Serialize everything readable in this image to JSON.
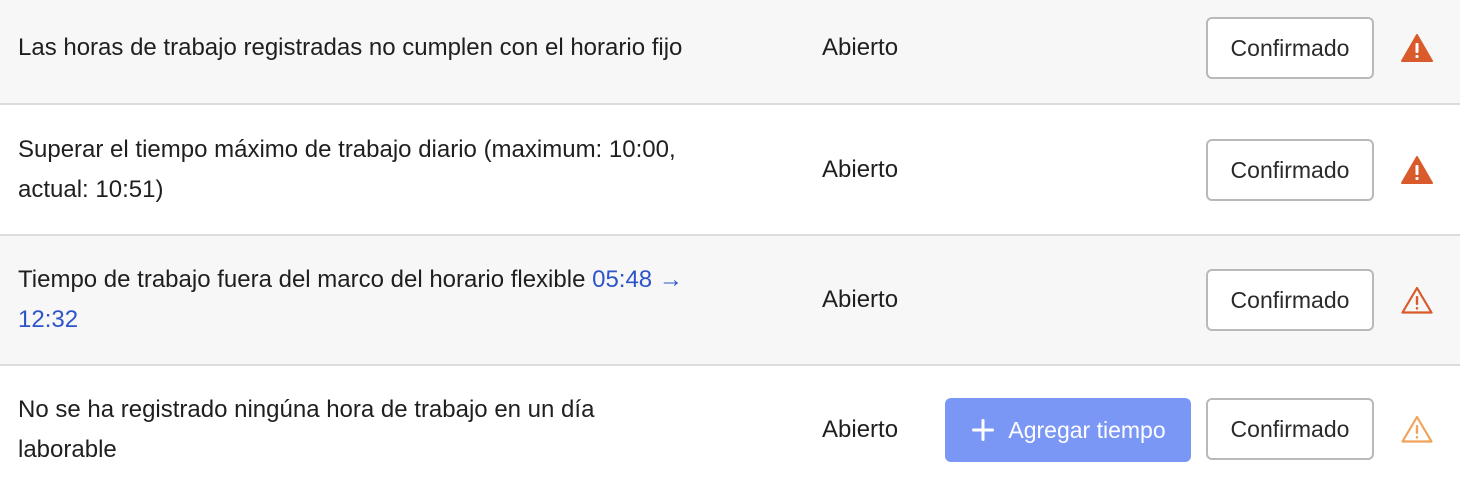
{
  "rows": [
    {
      "message": "Las horas de trabajo registradas no cumplen con el horario fijo",
      "status": "Abierto",
      "confirm_label": "Confirmado",
      "warning_icon": "warning-filled-icon",
      "warning_color": "#d95a2b"
    },
    {
      "message": "Superar el tiempo máximo de trabajo diario (maximum: 10:00, actual: 10:51)",
      "status": "Abierto",
      "confirm_label": "Confirmado",
      "warning_icon": "warning-filled-icon",
      "warning_color": "#d95a2b"
    },
    {
      "message": "Tiempo de trabajo fuera del marco del horario flexible",
      "time_range": "05:48 → 12:32",
      "status": "Abierto",
      "confirm_label": "Confirmado",
      "warning_icon": "warning-outline-icon",
      "warning_color": "#d95a2b"
    },
    {
      "message": "No se ha registrado ningúna hora de trabajo en un día laborable",
      "status": "Abierto",
      "add_time_label": "Agregar tiempo",
      "confirm_label": "Confirmado",
      "warning_icon": "warning-outline-icon",
      "warning_color": "#f0a35a"
    }
  ],
  "colors": {
    "link": "#2d55c9",
    "primary_button": "#7b97f6",
    "row_alt_background": "#f7f7f7",
    "divider": "#dcdcdc"
  }
}
